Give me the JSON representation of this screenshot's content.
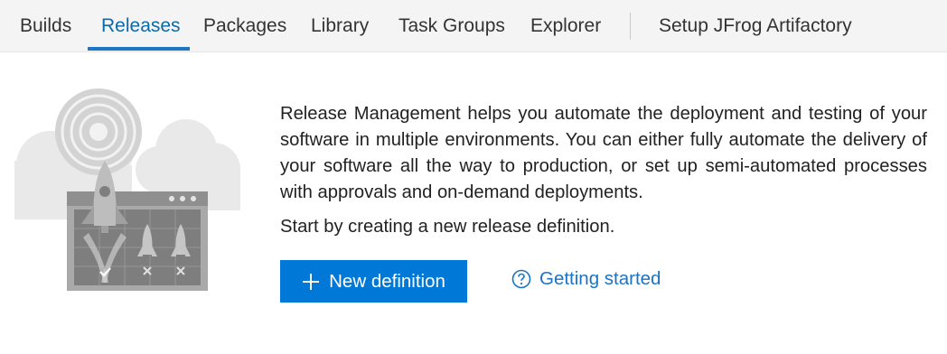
{
  "tabs": [
    {
      "label": "Builds",
      "active": false
    },
    {
      "label": "Releases",
      "active": true
    },
    {
      "label": "Packages",
      "active": false
    },
    {
      "label": "Library",
      "active": false
    },
    {
      "label": "Task Groups",
      "active": false
    },
    {
      "label": "Explorer",
      "active": false
    }
  ],
  "extension_tab": {
    "label": "Setup JFrog Artifactory"
  },
  "main": {
    "description": "Release Management helps you automate the deployment and testing of your software in multiple environments. You can either fully automate the delivery of your software all the way to production, or set up semi-automated processes with approvals and on-demand deployments.",
    "start_text": "Start by creating a new release definition.",
    "new_definition_label": "New definition",
    "getting_started_label": "Getting started"
  },
  "icons": {
    "new_definition": "plus-icon",
    "getting_started": "help-circle-icon",
    "illustration": "rocket-launch-illustration"
  },
  "colors": {
    "accent": "#0078d7",
    "link": "#1a73c4",
    "active_tab": "#0b6aa8",
    "tab_underline": "#1d76c6",
    "tabbar_bg": "#f4f4f4"
  }
}
